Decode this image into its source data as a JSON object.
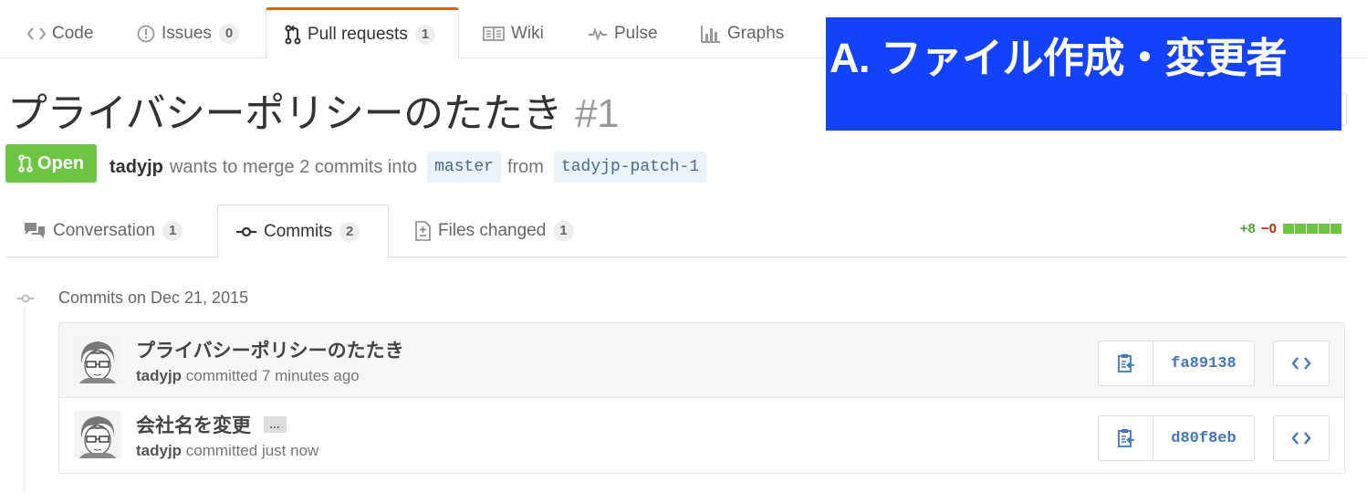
{
  "repo_nav": {
    "tabs": [
      {
        "label": "Code",
        "icon": "code-icon"
      },
      {
        "label": "Issues",
        "icon": "issue-opened-icon",
        "count": "0"
      },
      {
        "label": "Pull requests",
        "icon": "git-pull-request-icon",
        "count": "1",
        "selected": true
      },
      {
        "label": "Wiki",
        "icon": "book-icon"
      },
      {
        "label": "Pulse",
        "icon": "pulse-icon"
      },
      {
        "label": "Graphs",
        "icon": "graph-icon"
      }
    ]
  },
  "pull_request": {
    "title": "プライバシーポリシーのたたき",
    "number": "#1",
    "state": "Open",
    "author": "tadyjp",
    "merge_text": "wants to merge 2 commits into",
    "base_branch": "master",
    "from_text": "from",
    "head_branch": "tadyjp-patch-1"
  },
  "pr_tabs": [
    {
      "label": "Conversation",
      "icon": "comment-discussion-icon",
      "count": "1"
    },
    {
      "label": "Commits",
      "icon": "git-commit-icon",
      "count": "2",
      "selected": true
    },
    {
      "label": "Files changed",
      "icon": "diff-icon",
      "count": "1"
    }
  ],
  "diffstat": {
    "additions": "+8",
    "deletions": "−0"
  },
  "commits": {
    "date_heading": "Commits on Dec 21, 2015",
    "items": [
      {
        "title": "プライバシーポリシーのたたき",
        "author": "tadyjp",
        "action": "committed",
        "time": "7 minutes ago",
        "sha": "fa89138",
        "has_ellipsis": false
      },
      {
        "title": "会社名を変更",
        "author": "tadyjp",
        "action": "committed",
        "time": "just now",
        "sha": "d80f8eb",
        "has_ellipsis": true
      }
    ],
    "ellipsis_label": "…"
  },
  "annotation": {
    "text": "A. ファイル作成・変更者",
    "color": "#1342ff"
  },
  "colors": {
    "accent_tab": "#d26911",
    "open_state": "#6cc644",
    "link": "#4078c0",
    "addition": "#55a532",
    "deletion": "#bd2c00"
  }
}
